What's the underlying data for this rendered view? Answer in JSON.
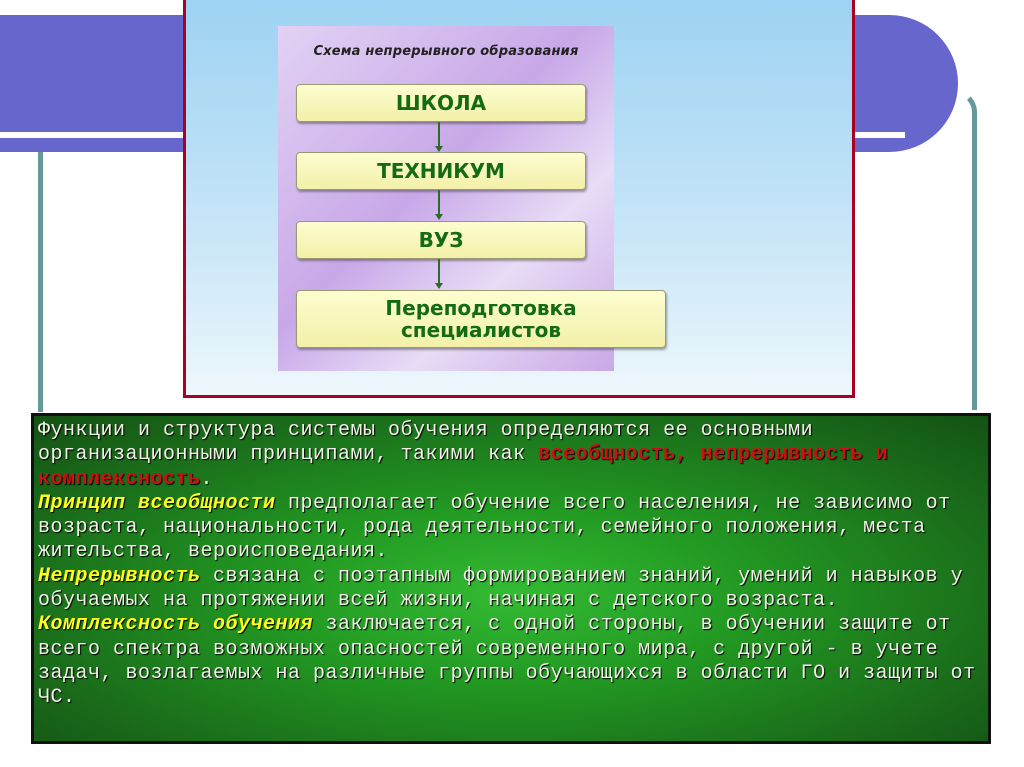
{
  "slide": {
    "scheme": {
      "title": "Схема непрерывного образования",
      "steps": [
        {
          "label": "ШКОЛА"
        },
        {
          "label": "ТЕХНИКУМ"
        },
        {
          "label": "ВУЗ"
        },
        {
          "label": "Переподготовка специалистов"
        }
      ]
    },
    "text": {
      "intro": "Функции и структура системы обучения определяются ее основными организационными принципами, такими как ",
      "principles_highlight": "всеобщность, непрерывность и комплексность",
      "intro_end": ".",
      "p1_term": "Принцип всеобщности",
      "p1_body": " предполагает обучение всего населения, не зависимо от возраста, национальности, рода деятельности, семейного положения, места жительства, вероисповедания.",
      "p2_term": "Непрерывность",
      "p2_body": " связана с поэтапным формированием знаний, умений и навыков у обучаемых на протяжении всей жизни, начиная с детского возраста.",
      "p3_term": "Комплексность обучения",
      "p3_body": " заключается, с одной стороны, в обучении защите от всего спектра возможных опасностей современного мира, с другой - в учете задач, возлагаемых на различные группы обучающихся в области ГО и защиты от ЧС."
    },
    "colors": {
      "band": "#6666cc",
      "frame": "#aa0022",
      "accent_teal": "#669999",
      "highlight_red": "#cc1111",
      "highlight_yellow": "#ffff22",
      "panel_green": "#229922"
    }
  }
}
